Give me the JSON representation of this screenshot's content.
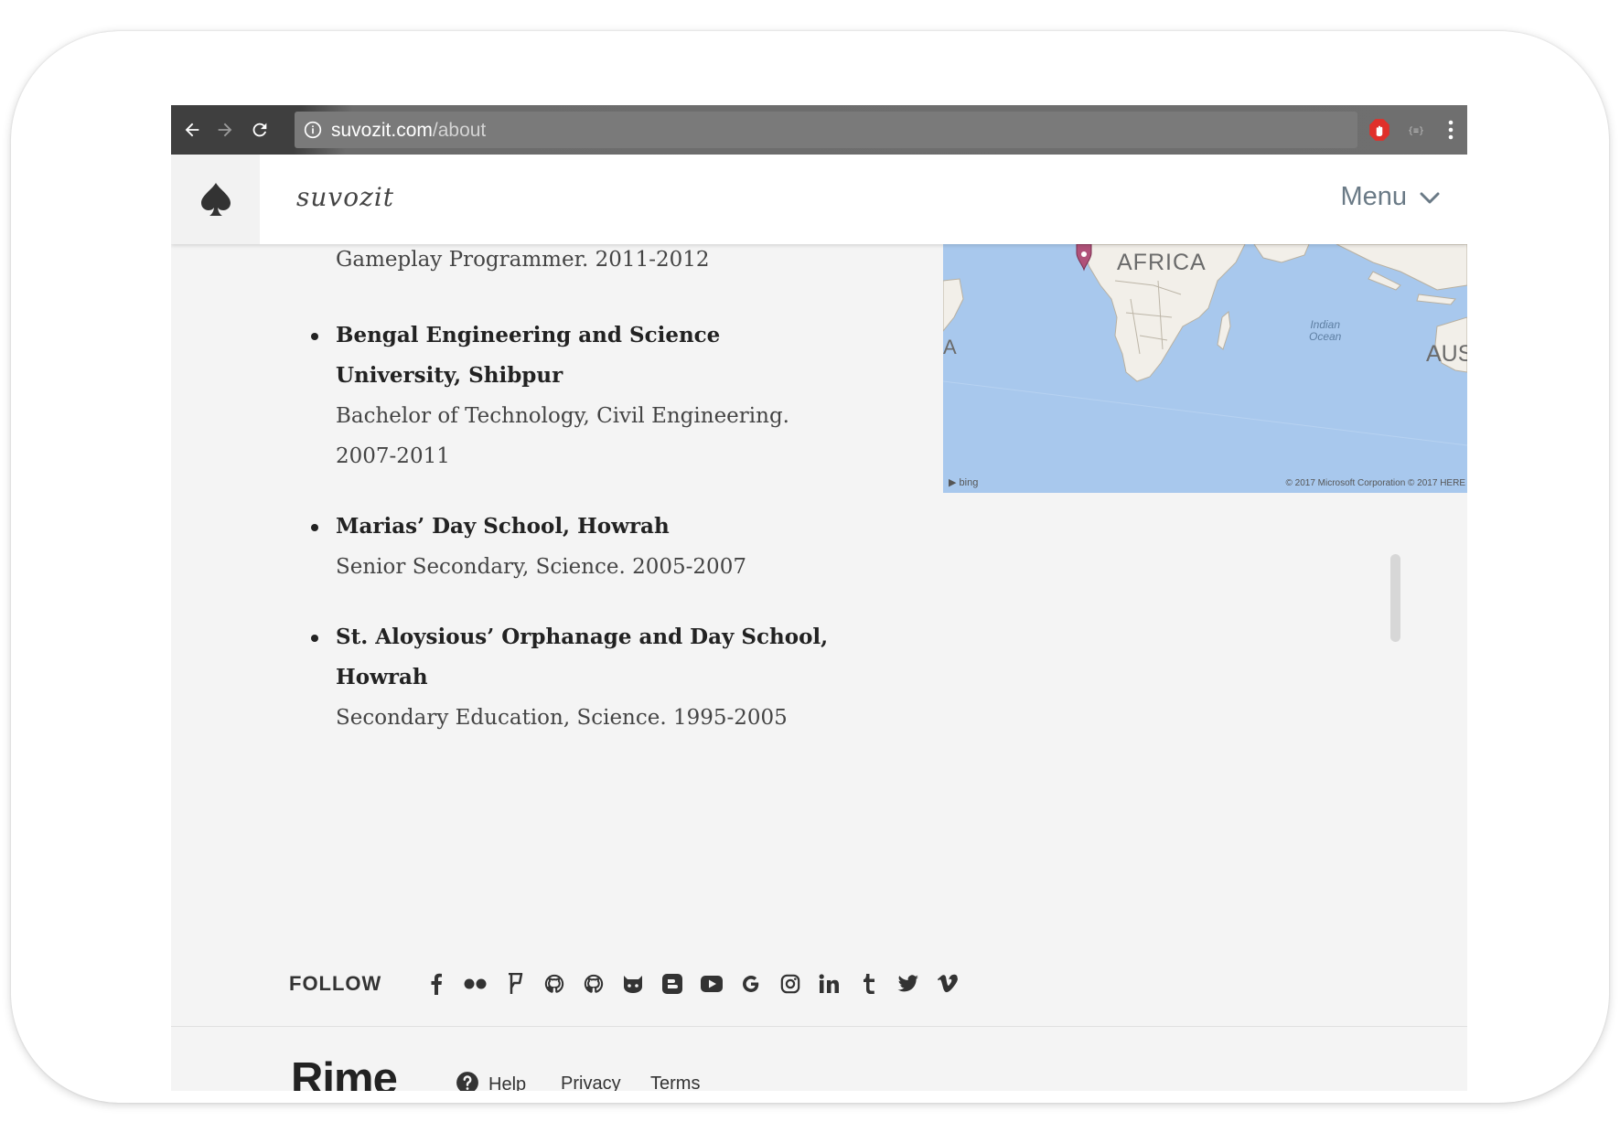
{
  "browser": {
    "url_host": "suvozit.com",
    "url_path": "/about",
    "icons": [
      "back-arrow-icon",
      "forward-arrow-icon",
      "reload-icon",
      "info-icon",
      "star-icon",
      "adblock-icon",
      "extension-icon",
      "kebab-menu-icon"
    ]
  },
  "header": {
    "wordmark": "suvozit",
    "menu_label": "Menu"
  },
  "map": {
    "labels": {
      "africa": "AFRICA",
      "a": "A",
      "aus": "AUS",
      "ocean_line1": "Indian",
      "ocean_line2": "Ocean"
    },
    "bing": "bing",
    "copyright": "© 2017 Microsoft Corporation © 2017 HERE"
  },
  "education": {
    "previous_desc": "Gameplay Programmer. 2011-2012",
    "items": [
      {
        "name": "Bengal Engineering and Science University, Shibpur",
        "desc": "Bachelor of Technology, Civil Engineering. 2007-2011"
      },
      {
        "name": "Marias’ Day School, Howrah",
        "desc": "Senior Secondary, Science. 2005-2007"
      },
      {
        "name": "St. Aloysious’ Orphanage and Day School, Howrah",
        "desc": "Secondary Education, Science. 1995-2005"
      }
    ]
  },
  "follow": {
    "label": "FOLLOW",
    "icons": [
      "facebook-icon",
      "flickr-icon",
      "foursquare-icon",
      "github-icon",
      "github-alt-icon",
      "github-cat-icon",
      "blogger-icon",
      "youtube-icon",
      "google-icon",
      "instagram-icon",
      "linkedin-icon",
      "tumblr-icon",
      "twitter-icon",
      "vimeo-icon"
    ]
  },
  "footer": {
    "brand": "Rime",
    "help": "Help",
    "privacy": "Privacy",
    "terms": "Terms"
  }
}
